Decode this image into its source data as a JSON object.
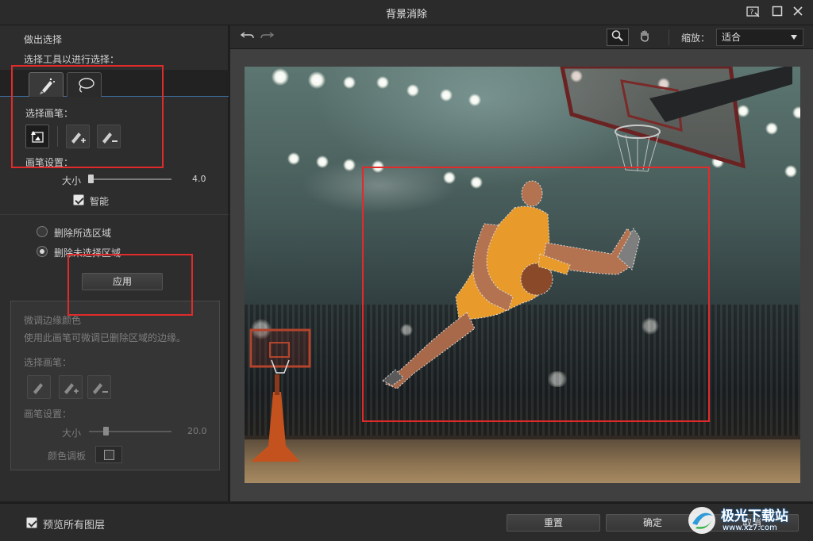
{
  "window": {
    "title": "背景消除",
    "help_icon": "help-icon",
    "maximize_icon": "maximize-icon",
    "close_icon": "close-icon"
  },
  "left_panel": {
    "section_title": "做出选择",
    "select_tool_label": "选择工具以进行选择：",
    "tabs": [
      {
        "name": "brush-tab",
        "icon": "smart-brush-icon"
      },
      {
        "name": "lasso-tab",
        "icon": "lasso-icon"
      }
    ],
    "brush_label": "选择画笔：",
    "brush_tools": [
      "auto-select-icon",
      "add-brush-icon",
      "subtract-brush-icon"
    ],
    "brush_settings_label": "画笔设置：",
    "size_label": "大小",
    "size_value": "4.0",
    "smart_label": "智能",
    "radio_delete_selected": "删除所选区域",
    "radio_delete_unselected": "删除未选择区域",
    "apply_label": "应用"
  },
  "fine_tune": {
    "title": "微调边缘颜色",
    "description": "使用此画笔可微调已删除区域的边缘。",
    "brush_label": "选择画笔：",
    "brush_settings_label": "画笔设置：",
    "size_label": "大小",
    "size_value": "20.0",
    "palette_label": "颜色调板"
  },
  "toolbar": {
    "undo_icon": "undo-icon",
    "redo_icon": "redo-icon",
    "zoom_tool_icon": "magnifier-icon",
    "pan_tool_icon": "hand-icon",
    "zoom_label": "缩放：",
    "zoom_value": "适合"
  },
  "bottom": {
    "preview_all_layers": "预览所有图层",
    "reset_label": "重置",
    "ok_label": "确定",
    "cancel_label": "取消",
    "watermark": "极光下载站",
    "watermark_url": "www.xz7.com"
  },
  "colors": {
    "annotation_red": "#e12b2b",
    "selection_blue": "#3c6a9a",
    "jersey_orange": "#e89a2a"
  }
}
